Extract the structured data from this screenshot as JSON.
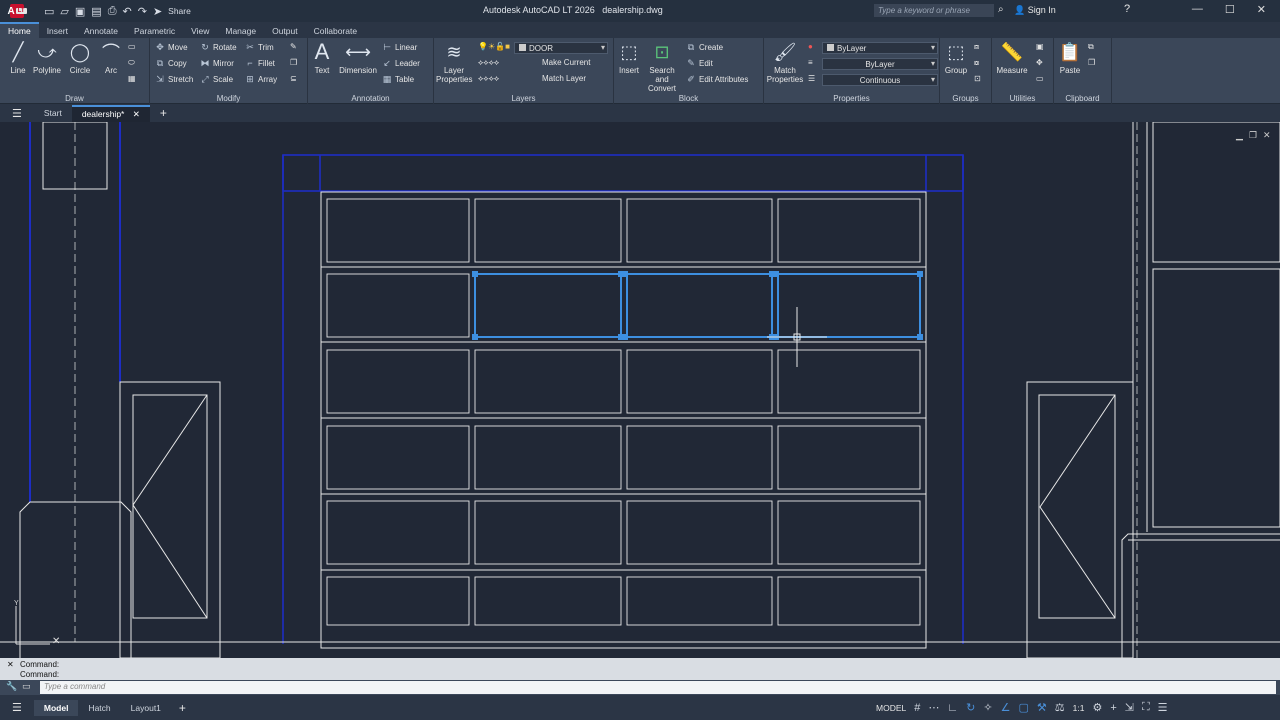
{
  "title_bar": {
    "app_name": "Autodesk AutoCAD LT 2026",
    "file_name": "dealership.dwg",
    "share_label": "Share",
    "search_placeholder": "Type a keyword or phrase",
    "sign_in_label": "Sign In"
  },
  "ribbon_tabs": [
    "Home",
    "Insert",
    "Annotate",
    "Parametric",
    "View",
    "Manage",
    "Output",
    "Collaborate"
  ],
  "ribbon": {
    "draw": {
      "title": "Draw",
      "line": "Line",
      "polyline": "Polyline",
      "circle": "Circle",
      "arc": "Arc"
    },
    "modify": {
      "title": "Modify",
      "move": "Move",
      "rotate": "Rotate",
      "trim": "Trim",
      "copy": "Copy",
      "mirror": "Mirror",
      "fillet": "Fillet",
      "stretch": "Stretch",
      "scale": "Scale",
      "array": "Array"
    },
    "annotation": {
      "title": "Annotation",
      "text": "Text",
      "dimension": "Dimension",
      "linear": "Linear",
      "leader": "Leader",
      "table": "Table"
    },
    "layers": {
      "title": "Layers",
      "layer_properties": "Layer Properties",
      "current_layer": "DOOR",
      "make_current": "Make Current",
      "match_layer": "Match Layer"
    },
    "block": {
      "title": "Block",
      "insert": "Insert",
      "search_convert": "Search and Convert",
      "create": "Create",
      "edit": "Edit",
      "edit_attributes": "Edit Attributes"
    },
    "properties": {
      "title": "Properties",
      "match_properties": "Match Properties",
      "color": "ByLayer",
      "lineweight": "ByLayer",
      "linetype": "Continuous"
    },
    "groups": {
      "title": "Groups",
      "group": "Group"
    },
    "utilities": {
      "title": "Utilities",
      "measure": "Measure"
    },
    "clipboard": {
      "title": "Clipboard",
      "paste": "Paste"
    }
  },
  "file_tabs": [
    "Start",
    "dealership*"
  ],
  "command": {
    "history": [
      "Command:",
      "Command:"
    ],
    "input_placeholder": "Type a command"
  },
  "status_bar": {
    "layout_tabs": [
      "Model",
      "Hatch",
      "Layout1"
    ],
    "model_label": "MODEL",
    "scale": "1:1"
  },
  "colors": {
    "selection": "#3d8fe0",
    "wall_blue": "#1d2dc4",
    "linework": "#e8e8e8",
    "background": "#212836"
  }
}
